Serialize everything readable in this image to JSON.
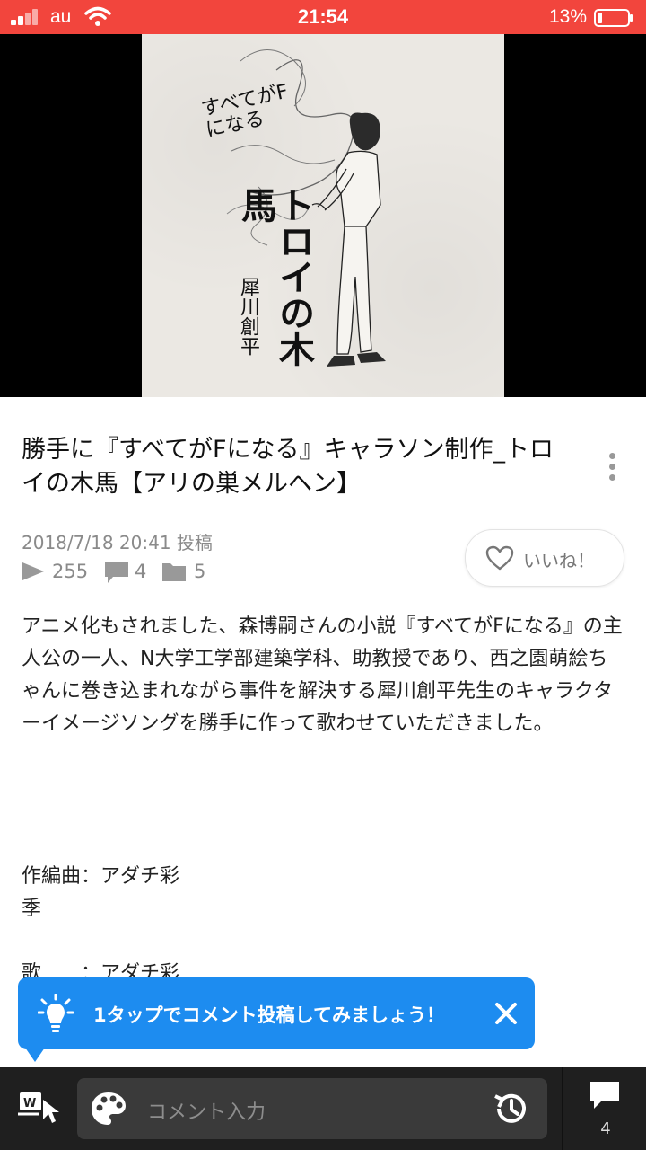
{
  "status_bar": {
    "carrier": "au",
    "time": "21:54",
    "battery": "13%"
  },
  "video": {
    "artwork_title_text": "すべてがFになる",
    "artwork_song_text": "トロイの木馬",
    "artwork_artist_text": "犀川創平"
  },
  "post": {
    "title": "勝手に『すべてがFになる』キャラソン制作_トロイの木馬【アリの巣メルヘン】",
    "posted": "2018/7/18 20:41 投稿",
    "plays": "255",
    "comments": "4",
    "mylists": "5",
    "like_label": "いいね！",
    "description": "アニメ化もされました、森博嗣さんの小説『すべてがFになる』の主人公の一人、N大学工学部建築学科、助教授であり、西之園萌絵ちゃんに巻き込まれながら事件を解決する犀川創平先生のキャラクターイメージソングを勝手に作って歌わせていただきました。",
    "credits": [
      "作編曲：アダチ彩",
      "季",
      "歌　　：アダチ彩"
    ]
  },
  "tooltip": {
    "text": "1タップでコメント投稿してみましょう！"
  },
  "bottom_bar": {
    "comment_placeholder": "コメント入力",
    "comment_count": "4"
  },
  "colors": {
    "status_bar": "#f2453d",
    "tooltip": "#1d8cf0",
    "bottom_bar": "#1f1f1f"
  }
}
